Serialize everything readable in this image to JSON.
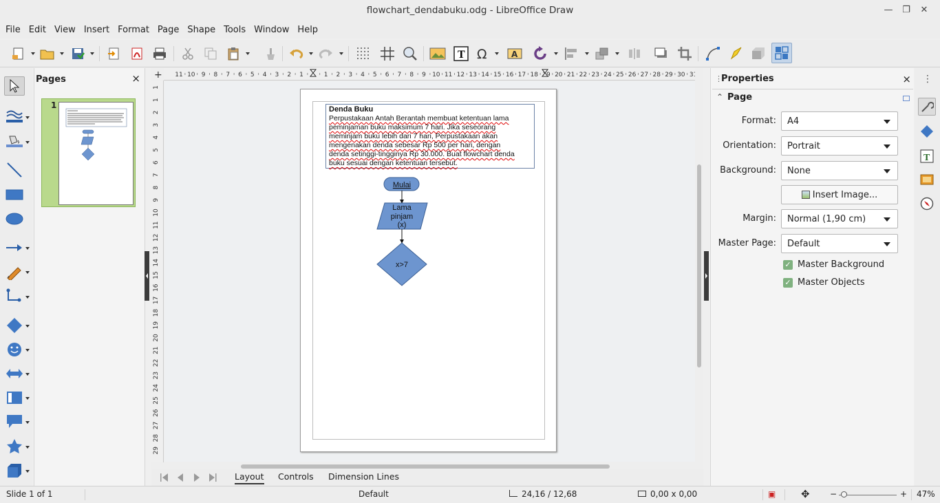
{
  "window": {
    "title": "flowchart_dendabuku.odg - LibreOffice Draw"
  },
  "menu": [
    "File",
    "Edit",
    "View",
    "Insert",
    "Format",
    "Page",
    "Shape",
    "Tools",
    "Window",
    "Help"
  ],
  "pages_panel": {
    "title": "Pages",
    "close": "×",
    "thumb_number": "1"
  },
  "ruler": {
    "h_ticks": [
      "11",
      "10",
      "9",
      "8",
      "7",
      "6",
      "5",
      "4",
      "3",
      "2",
      "1",
      "",
      "1",
      "2",
      "3",
      "4",
      "5",
      "6",
      "7",
      "8",
      "9",
      "10",
      "11",
      "12",
      "13",
      "14",
      "15",
      "16",
      "17",
      "18",
      "19",
      "20",
      "21",
      "22",
      "23",
      "24",
      "25",
      "26",
      "27",
      "28",
      "29",
      "30",
      "31"
    ],
    "v_ticks": [
      "1",
      "1",
      "2",
      "3",
      "4",
      "5",
      "6",
      "7",
      "8",
      "9",
      "10",
      "11",
      "12",
      "13",
      "14",
      "15",
      "16",
      "17",
      "18",
      "19",
      "20",
      "21",
      "22",
      "23",
      "24",
      "25",
      "26",
      "27",
      "28",
      "29"
    ]
  },
  "document": {
    "text_title": "Denda Buku",
    "text_body": "Perpustakaan Antah Berantah membuat ketentuan lama peminjaman buku maksimum 7 hari. Jika seseorang meminjam buku lebih dari 7 hari, Perpustakaan akan mengenakan denda sebesar Rp 500 per hari, dengan denda setinggi-tingginya Rp 30.000. Buat flowchart denda buku sesuai dengan ketentuan tersebut.",
    "text_lines": [
      "Perpustakaan Antah Berantah membuat ketentuan lama",
      "peminjaman buku maksimum 7 hari. Jika seseorang",
      "meminjam buku lebih dari 7 hari, Perpustakaan akan",
      "mengenakan denda sebesar Rp 500 per hari, dengan",
      "denda setinggi-tingginya Rp 30.000. Buat flowchart denda",
      "buku sesuai dengan ketentuan tersebut."
    ],
    "shapes": {
      "start": "Mulai",
      "input_l1": "Lama",
      "input_l2": "pinjam",
      "input_l3": "(x)",
      "decision": "x>7"
    },
    "shape_fill": "#6d95cf",
    "shape_stroke": "#3b5f94"
  },
  "tabs": [
    "Layout",
    "Controls",
    "Dimension Lines"
  ],
  "properties": {
    "title": "Properties",
    "close": "×",
    "section": "Page",
    "format_label": "Format:",
    "format_value": "A4",
    "orientation_label": "Orientation:",
    "orientation_value": "Portrait",
    "background_label": "Background:",
    "background_value": "None",
    "insert_image": "Insert Image...",
    "margin_label": "Margin:",
    "margin_value": "Normal (1,90 cm)",
    "master_page_label": "Master Page:",
    "master_page_value": "Default",
    "master_background": "Master Background",
    "master_objects": "Master Objects"
  },
  "status": {
    "slide": "Slide 1 of 1",
    "master": "Default",
    "position": "24,16 / 12,68",
    "size": "0,00 x 0,00",
    "zoom": "47%"
  },
  "colors": {
    "accent_green": "#b9d98c",
    "check_green": "#7fb17f"
  }
}
